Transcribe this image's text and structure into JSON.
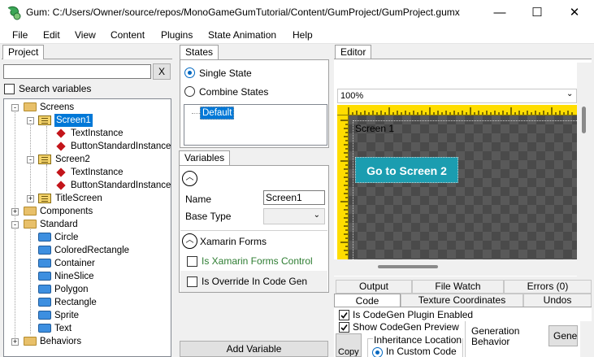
{
  "window": {
    "title": "Gum: C:/Users/Owner/source/repos/MonoGameGumTutorial/Content/GumProject/GumProject.gumx",
    "minimize": "—",
    "maximize": "☐",
    "close": "✕"
  },
  "menu": [
    "File",
    "Edit",
    "View",
    "Content",
    "Plugins",
    "State Animation",
    "Help"
  ],
  "project": {
    "tab": "Project",
    "search_value": "",
    "clear_label": "X",
    "search_variables_label": "Search variables",
    "search_variables_checked": false,
    "tree": [
      {
        "label": "Screens",
        "kind": "folder",
        "level": 0,
        "expander": "-"
      },
      {
        "label": "Screen1",
        "kind": "screen",
        "level": 1,
        "expander": "-",
        "selected": true
      },
      {
        "label": "TextInstance",
        "kind": "instance",
        "level": 2
      },
      {
        "label": "ButtonStandardInstance",
        "kind": "instance",
        "level": 2
      },
      {
        "label": "Screen2",
        "kind": "screen",
        "level": 1,
        "expander": "-"
      },
      {
        "label": "TextInstance",
        "kind": "instance",
        "level": 2
      },
      {
        "label": "ButtonStandardInstance",
        "kind": "instance",
        "level": 2
      },
      {
        "label": "TitleScreen",
        "kind": "screen",
        "level": 1,
        "expander": "+"
      },
      {
        "label": "Components",
        "kind": "folder",
        "level": 0,
        "expander": "+"
      },
      {
        "label": "Standard",
        "kind": "folder",
        "level": 0,
        "expander": "-"
      },
      {
        "label": "Circle",
        "kind": "standard",
        "level": 1
      },
      {
        "label": "ColoredRectangle",
        "kind": "standard",
        "level": 1
      },
      {
        "label": "Container",
        "kind": "standard",
        "level": 1
      },
      {
        "label": "NineSlice",
        "kind": "standard",
        "level": 1
      },
      {
        "label": "Polygon",
        "kind": "standard",
        "level": 1
      },
      {
        "label": "Rectangle",
        "kind": "standard",
        "level": 1
      },
      {
        "label": "Sprite",
        "kind": "standard",
        "level": 1
      },
      {
        "label": "Text",
        "kind": "standard",
        "level": 1
      },
      {
        "label": "Behaviors",
        "kind": "folder",
        "level": 0,
        "expander": "+"
      }
    ]
  },
  "states": {
    "tab": "States",
    "single_state": "Single State",
    "combine_states": "Combine States",
    "selected_mode": "single",
    "items": [
      "Default"
    ]
  },
  "variables": {
    "tab": "Variables",
    "name_label": "Name",
    "name_value": "Screen1",
    "base_type_label": "Base Type",
    "base_type_value": "",
    "xamarin_header": "Xamarin Forms",
    "is_xamarin_control": "Is Xamarin Forms Control",
    "is_override_codegen": "Is Override In Code Gen",
    "add_variable": "Add Variable"
  },
  "editor": {
    "tab": "Editor",
    "zoom": "100%",
    "screen_label": "Screen 1",
    "button_text": "Go to Screen 2"
  },
  "bottom_tabs": {
    "row1": [
      "Output",
      "File Watch",
      "Errors (0)"
    ],
    "row2": [
      "Code",
      "Texture Coordinates",
      "Undos"
    ],
    "active": "Code"
  },
  "codegen": {
    "plugin_enabled": "Is CodeGen Plugin Enabled",
    "show_preview": "Show CodeGen Preview",
    "inheritance_location": "Inheritance Location",
    "in_custom_code": "In Custom Code",
    "generation_behavior": "Generation Behavior",
    "gen_button": "Gene",
    "copy_button": "Copy"
  },
  "colors": {
    "accent": "#0078d7",
    "ruler": "#ffdd00",
    "button": "#1b9db0",
    "canvas": "#595959",
    "xamarin_green": "#2e7d32"
  }
}
